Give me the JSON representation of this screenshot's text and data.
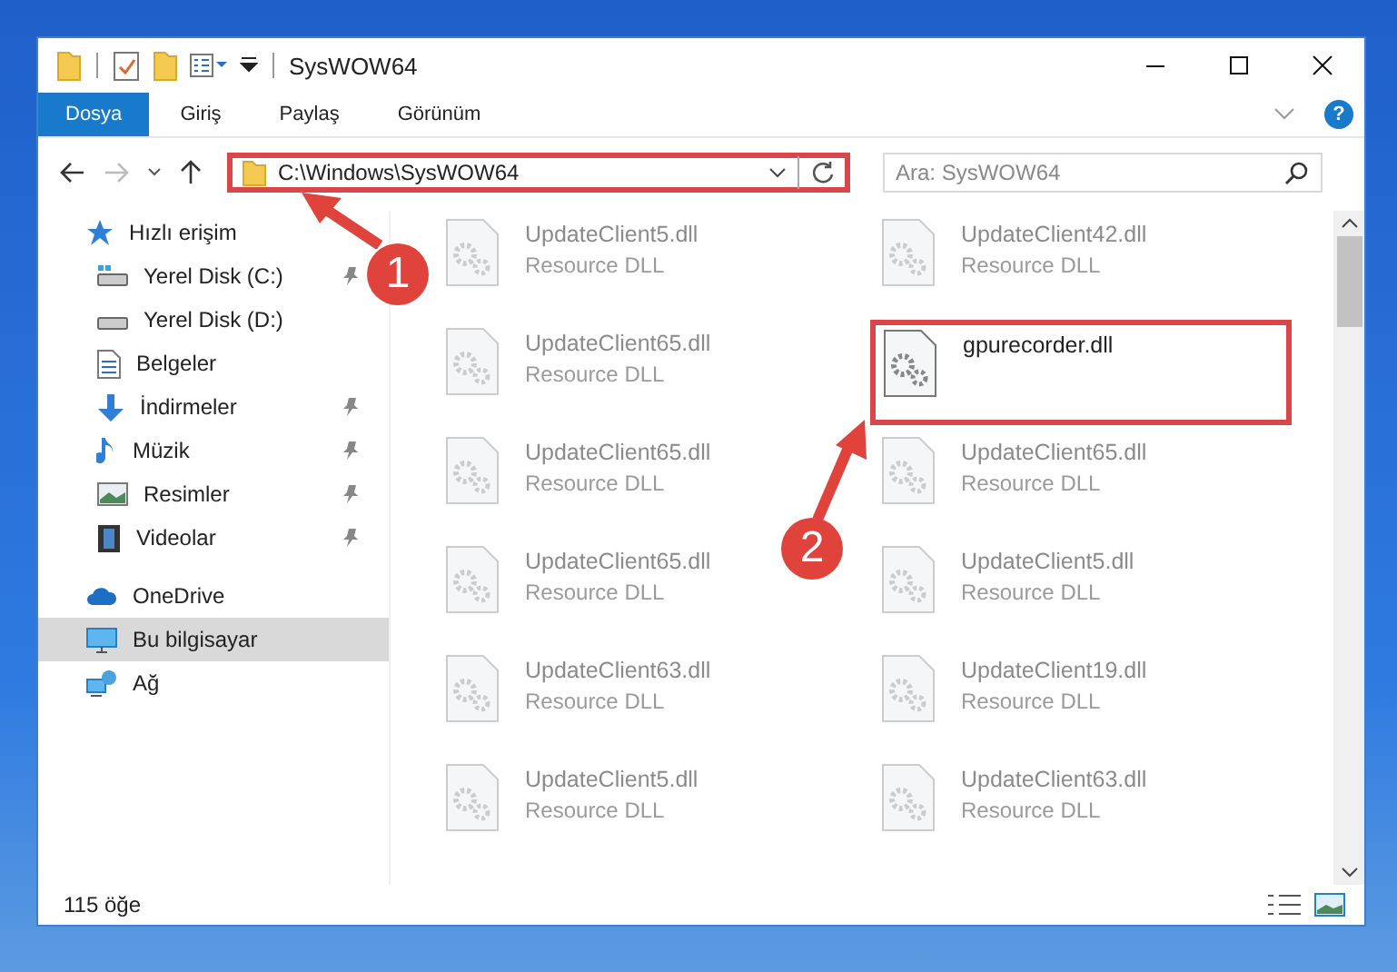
{
  "window": {
    "title": "SysWOW64"
  },
  "ribbon_tabs": [
    {
      "label": "Dosya",
      "selected": true
    },
    {
      "label": "Giriş",
      "selected": false
    },
    {
      "label": "Paylaş",
      "selected": false
    },
    {
      "label": "Görünüm",
      "selected": false
    }
  ],
  "help": {
    "label": "?"
  },
  "address_bar": {
    "path": "C:\\Windows\\SysWOW64",
    "highlighted": true
  },
  "search": {
    "placeholder": "Ara: SysWOW64"
  },
  "sidebar": {
    "items": [
      {
        "label": "Hızlı erişim",
        "selected": false,
        "children": [
          {
            "label": "Yerel Disk (C:)",
            "selected": false,
            "pinned": true
          },
          {
            "label": "Yerel Disk (D:)",
            "selected": false,
            "pinned": false
          },
          {
            "label": "Belgeler",
            "selected": false,
            "pinned": false
          },
          {
            "label": "İndirmeler",
            "selected": false,
            "pinned": true
          },
          {
            "label": "Müzik",
            "selected": false,
            "pinned": true
          },
          {
            "label": "Resimler",
            "selected": false,
            "pinned": true
          },
          {
            "label": "Videolar",
            "selected": false,
            "pinned": true
          }
        ]
      },
      {
        "label": "OneDrive",
        "selected": false
      },
      {
        "label": "Bu bilgisayar",
        "selected": true
      },
      {
        "label": "Ağ",
        "selected": false
      }
    ]
  },
  "files": [
    {
      "name": "UpdateClient5.dll",
      "type": "Resource DLL",
      "highlighted": false
    },
    {
      "name": "UpdateClient42.dll",
      "type": "Resource DLL",
      "highlighted": false
    },
    {
      "name": "UpdateClient65.dll",
      "type": "Resource DLL",
      "highlighted": false
    },
    {
      "name": "gpurecorder.dll",
      "highlighted": true
    },
    {
      "name": "UpdateClient65.dll",
      "type": "Resource DLL",
      "highlighted": false
    },
    {
      "name": "UpdateClient65.dll",
      "type": "Resource DLL",
      "highlighted": false
    },
    {
      "name": "UpdateClient65.dll",
      "type": "Resource DLL",
      "highlighted": false
    },
    {
      "name": "UpdateClient5.dll",
      "type": "Resource DLL",
      "highlighted": false
    },
    {
      "name": "UpdateClient63.dll",
      "type": "Resource DLL",
      "highlighted": false
    },
    {
      "name": "UpdateClient19.dll",
      "type": "Resource DLL",
      "highlighted": false
    },
    {
      "name": "UpdateClient5.dll",
      "type": "Resource DLL",
      "highlighted": false
    },
    {
      "name": "UpdateClient63.dll",
      "type": "Resource DLL",
      "highlighted": false
    }
  ],
  "status_bar": {
    "count": "115 öğe"
  },
  "annotations": [
    {
      "number": "1"
    },
    {
      "number": "2"
    }
  ]
}
